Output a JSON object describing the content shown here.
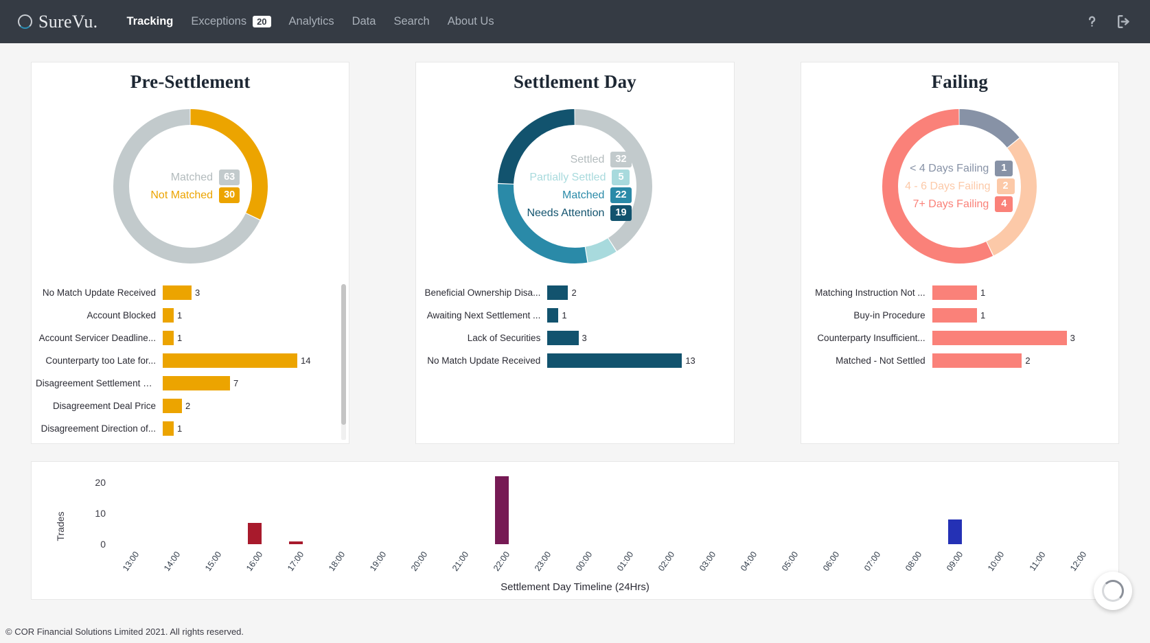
{
  "navbar": {
    "brand": "SureVu.",
    "links": [
      {
        "label": "Tracking",
        "active": true,
        "badge": null
      },
      {
        "label": "Exceptions",
        "active": false,
        "badge": "20"
      },
      {
        "label": "Analytics",
        "active": false,
        "badge": null
      },
      {
        "label": "Data",
        "active": false,
        "badge": null
      },
      {
        "label": "Search",
        "active": false,
        "badge": null
      },
      {
        "label": "About Us",
        "active": false,
        "badge": null
      }
    ],
    "help_icon": "question-mark-icon",
    "logout_icon": "logout-icon"
  },
  "cards": [
    {
      "title": "Pre-Settlement",
      "donut": {
        "segments": [
          {
            "label": "Matched",
            "value": 63,
            "color": "#c2cacc"
          },
          {
            "label": "Not Matched",
            "value": 30,
            "color": "#eca400"
          }
        ],
        "legend": [
          {
            "label": "Matched",
            "value": "63",
            "text_color": "#b3bbbd",
            "chip_color": "#c2cacc"
          },
          {
            "label": "Not Matched",
            "value": "30",
            "text_color": "#eca400",
            "chip_color": "#eca400"
          }
        ]
      },
      "bars": {
        "color": "#eca400",
        "max": 14,
        "scrollbar": true,
        "items": [
          {
            "label": "No Match Update Received",
            "value": 3
          },
          {
            "label": "Account Blocked",
            "value": 1
          },
          {
            "label": "Account Servicer Deadline...",
            "value": 1
          },
          {
            "label": "Counterparty too Late for...",
            "value": 14
          },
          {
            "label": "Disagreement Settlement D...",
            "value": 7
          },
          {
            "label": "Disagreement Deal Price",
            "value": 2
          },
          {
            "label": "Disagreement Direction of...",
            "value": 1
          }
        ]
      }
    },
    {
      "title": "Settlement Day",
      "donut": {
        "segments": [
          {
            "label": "Settled",
            "value": 32,
            "color": "#c2cacc"
          },
          {
            "label": "Partially Settled",
            "value": 5,
            "color": "#a8dadd"
          },
          {
            "label": "Matched",
            "value": 22,
            "color": "#2a8aa8"
          },
          {
            "label": "Needs Attention",
            "value": 19,
            "color": "#12536e"
          }
        ],
        "legend": [
          {
            "label": "Settled",
            "value": "32",
            "text_color": "#b3bbbd",
            "chip_color": "#c2cacc"
          },
          {
            "label": "Partially Settled",
            "value": "5",
            "text_color": "#a8dadd",
            "chip_color": "#a8dadd"
          },
          {
            "label": "Matched",
            "value": "22",
            "text_color": "#2a8aa8",
            "chip_color": "#2a8aa8"
          },
          {
            "label": "Needs Attention",
            "value": "19",
            "text_color": "#12536e",
            "chip_color": "#12536e"
          }
        ]
      },
      "bars": {
        "color": "#12536e",
        "max": 13,
        "scrollbar": false,
        "items": [
          {
            "label": "Beneficial Ownership Disa...",
            "value": 2
          },
          {
            "label": "Awaiting Next Settlement ...",
            "value": 1
          },
          {
            "label": "Lack of Securities",
            "value": 3
          },
          {
            "label": "No Match Update Received",
            "value": 13
          }
        ]
      }
    },
    {
      "title": "Failing",
      "donut": {
        "segments": [
          {
            "label": "< 4 Days Failing",
            "value": 1,
            "color": "#8792a6"
          },
          {
            "label": "4 - 6 Days Failing",
            "value": 2,
            "color": "#fcc9a8"
          },
          {
            "label": "7+ Days Failing",
            "value": 4,
            "color": "#fa8179"
          }
        ],
        "legend": [
          {
            "label": "< 4 Days Failing",
            "value": "1",
            "text_color": "#8792a6",
            "chip_color": "#8792a6"
          },
          {
            "label": "4 - 6 Days Failing",
            "value": "2",
            "text_color": "#fcc9a8",
            "chip_color": "#fcc9a8"
          },
          {
            "label": "7+ Days Failing",
            "value": "4",
            "text_color": "#fa8179",
            "chip_color": "#fa8179"
          }
        ]
      },
      "bars": {
        "color": "#fa8179",
        "max": 3,
        "scrollbar": false,
        "items": [
          {
            "label": "Matching Instruction Not ...",
            "value": 1
          },
          {
            "label": "Buy-in Procedure",
            "value": 1
          },
          {
            "label": "Counterparty Insufficient...",
            "value": 3
          },
          {
            "label": "Matched - Not Settled",
            "value": 2
          }
        ]
      }
    }
  ],
  "chart_data": {
    "type": "bar",
    "title": "",
    "xlabel": "Settlement Day Timeline (24Hrs)",
    "ylabel": "Trades",
    "ylim": [
      0,
      24
    ],
    "yticks": [
      "0",
      "10",
      "20"
    ],
    "ytick_values": [
      0,
      10,
      20
    ],
    "grid": false,
    "legend": "none",
    "categories": [
      "13:00",
      "14:00",
      "15:00",
      "16:00",
      "17:00",
      "18:00",
      "19:00",
      "20:00",
      "21:00",
      "22:00",
      "23:00",
      "00:00",
      "01:00",
      "02:00",
      "03:00",
      "04:00",
      "05:00",
      "06:00",
      "07:00",
      "08:00",
      "09:00",
      "10:00",
      "11:00",
      "12:00"
    ],
    "values": [
      0,
      0,
      0,
      7,
      1,
      0,
      0,
      0,
      0,
      22,
      0,
      0,
      0,
      0,
      0,
      0,
      0,
      0,
      0,
      0,
      8,
      0,
      0,
      0
    ],
    "bar_colors": [
      "",
      "",
      "",
      "#a81a2c",
      "#a81a2c",
      "",
      "",
      "",
      "",
      "#761a54",
      "",
      "",
      "",
      "",
      "",
      "",
      "",
      "",
      "",
      "",
      "#2431b5",
      "",
      "",
      ""
    ]
  },
  "spinner": {
    "icon": "loading-spinner-icon"
  },
  "footer": {
    "copyright": "© COR Financial Solutions Limited 2021. All rights reserved."
  }
}
